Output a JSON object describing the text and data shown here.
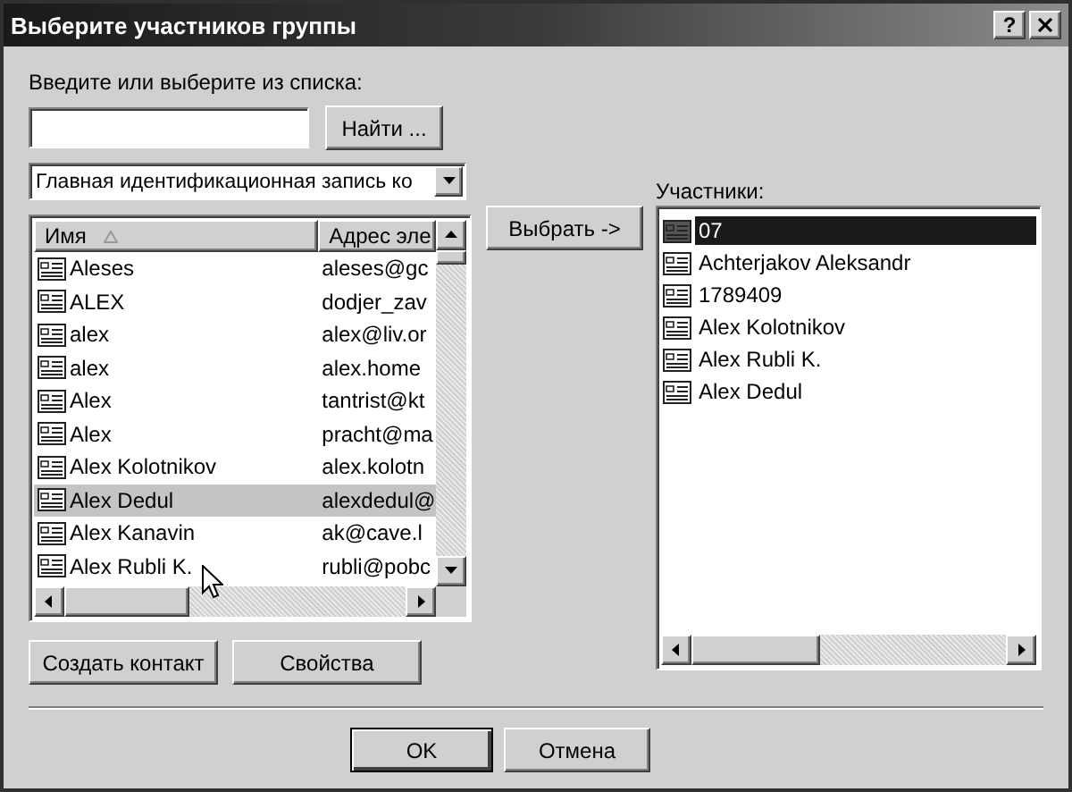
{
  "window": {
    "title": "Выберите участников группы",
    "help_button": "?"
  },
  "search": {
    "label": "Введите или выберите из списка:",
    "find_button": "Найти ..."
  },
  "address_book": {
    "selected_source": "Главная идентификационная запись ко"
  },
  "contacts": {
    "columns": [
      {
        "label": "Имя",
        "sorted": true
      },
      {
        "label": "Адрес эле"
      }
    ],
    "rows": [
      {
        "name": "Aleses",
        "email": "aleses@gc",
        "selected": false
      },
      {
        "name": "ALEX",
        "email": "dodjer_zav",
        "selected": false
      },
      {
        "name": "alex",
        "email": "alex@liv.or",
        "selected": false
      },
      {
        "name": "alex",
        "email": "alex.home",
        "selected": false
      },
      {
        "name": "Alex",
        "email": "tantrist@kt",
        "selected": false
      },
      {
        "name": "Alex",
        "email": "pracht@ma",
        "selected": false
      },
      {
        "name": "Alex  Kolotnikov",
        "email": "alex.kolotn",
        "selected": false
      },
      {
        "name": "Alex Dedul",
        "email": "alexdedul@",
        "selected": true
      },
      {
        "name": "Alex Kanavin",
        "email": "ak@cave.l",
        "selected": false
      },
      {
        "name": "Alex Rubli K.",
        "email": "rubli@pobc",
        "selected": false
      }
    ]
  },
  "select_button": "Выбрать ->",
  "members": {
    "label": "Участники:",
    "items": [
      {
        "name": "07",
        "selected": true
      },
      {
        "name": "Achterjakov Aleksandr",
        "selected": false
      },
      {
        "name": "1789409",
        "selected": false
      },
      {
        "name": "Alex  Kolotnikov",
        "selected": false
      },
      {
        "name": "Alex Rubli K.",
        "selected": false
      },
      {
        "name": "Alex Dedul",
        "selected": false
      }
    ]
  },
  "actions": [
    "Создать контакт",
    "Свойства"
  ],
  "dialog_buttons": [
    {
      "label": "OK",
      "default": true
    },
    {
      "label": "Отмена",
      "default": false
    }
  ]
}
